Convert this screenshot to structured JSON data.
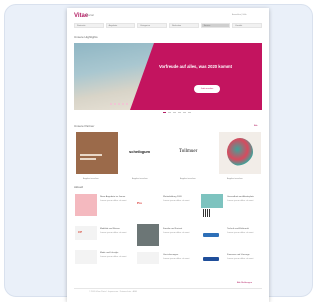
{
  "header": {
    "logo": "Vitae",
    "logo_sub": "Portal",
    "top_links": "Anmelden  |  Hilfe"
  },
  "nav": {
    "items": [
      "Startseite",
      "Angebote",
      "Kategorien",
      "Neuheiten",
      "Service",
      "Kontakt"
    ],
    "active_index": 4
  },
  "highlights": {
    "title": "Unsere Highlights",
    "banner_text": "Vorfreude auf alles, was 2020 kommt",
    "banner_button": "Jetzt ansehen",
    "slide_count": 6,
    "active_slide": 0
  },
  "partners": {
    "title": "Unsere Partner",
    "more_link": "Alle",
    "tiles": [
      {
        "name": "Partner 1",
        "caption": "Angebot ansehen"
      },
      {
        "name": "scheibgum",
        "caption": "Angebot ansehen"
      },
      {
        "name": "Tollmuer",
        "caption": "Angebot ansehen"
      },
      {
        "name": "Partner 4",
        "caption": "Angebot ansehen"
      }
    ]
  },
  "news": {
    "title": "Aktuell",
    "items": [
      {
        "headline": "Neue Angebote im Januar",
        "text": "Lorem ipsum dolor sit amet"
      },
      {
        "headline": "Weiterbildung 2020",
        "text": "Lorem ipsum dolor sit amet"
      },
      {
        "headline": "Gesundheit am Arbeitsplatz",
        "text": "Lorem ipsum dolor sit amet"
      },
      {
        "headline": "Mobilität und Reisen",
        "text": "Lorem ipsum dolor sit amet"
      },
      {
        "headline": "Familie und Freizeit",
        "text": "Lorem ipsum dolor sit amet"
      },
      {
        "headline": "Technik und Elektronik",
        "text": "Lorem ipsum dolor sit amet"
      },
      {
        "headline": "Mode und Lifestyle",
        "text": "Lorem ipsum dolor sit amet"
      },
      {
        "headline": "Versicherungen",
        "text": "Lorem ipsum dolor sit amet"
      },
      {
        "headline": "Finanzen und Vorsorge",
        "text": "Lorem ipsum dolor sit amet"
      }
    ],
    "more_link": "Alle Meldungen"
  },
  "footer": {
    "text": "© 2020 Vitae Portal  ·  Impressum  ·  Datenschutz  ·  AGB"
  },
  "colors": {
    "brand": "#b31f64",
    "banner": "#c3145f",
    "card_bg": "#eaf0f9"
  }
}
